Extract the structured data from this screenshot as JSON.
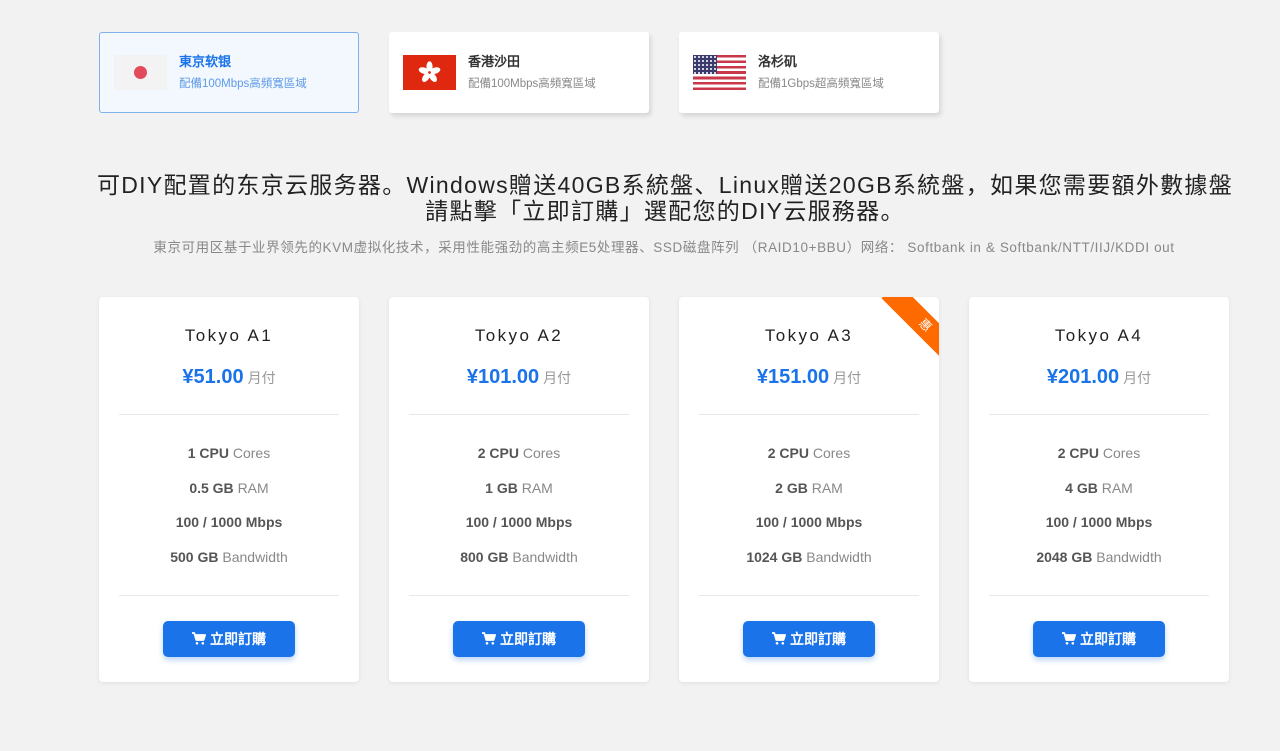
{
  "regions": [
    {
      "name": "東京软银",
      "desc": "配備100Mbps高頻寬區域"
    },
    {
      "name": "香港沙田",
      "desc": "配備100Mbps高頻寬區域"
    },
    {
      "name": "洛杉矶",
      "desc": "配備1Gbps超高頻寬區域"
    }
  ],
  "headline": "可DIY配置的东京云服务器。Windows贈送40GB系統盤、Linux贈送20GB系統盤，如果您需要額外數據盤請點擊「立即訂購」選配您的DIY云服務器。",
  "subline": "東京可用区基于业界领先的KVM虚拟化技术，采用性能强劲的高主频E5处理器、SSD磁盘阵列 （RAID10+BBU）网络： Softbank in & Softbank/NTT/IIJ/KDDI out",
  "buy_label": "立即訂購",
  "period_label": "月付",
  "ribbon_label": "惠",
  "plans": [
    {
      "name": "Tokyo A1",
      "price": "¥51.00",
      "cpu": "1 CPU",
      "cpu_unit": "Cores",
      "ram": "0.5 GB",
      "ram_unit": "RAM",
      "port": "100 / 1000 Mbps",
      "bw": "500 GB",
      "bw_unit": "Bandwidth"
    },
    {
      "name": "Tokyo A2",
      "price": "¥101.00",
      "cpu": "2 CPU",
      "cpu_unit": "Cores",
      "ram": "1 GB",
      "ram_unit": "RAM",
      "port": "100 / 1000 Mbps",
      "bw": "800 GB",
      "bw_unit": "Bandwidth"
    },
    {
      "name": "Tokyo A3",
      "price": "¥151.00",
      "cpu": "2 CPU",
      "cpu_unit": "Cores",
      "ram": "2 GB",
      "ram_unit": "RAM",
      "port": "100 / 1000 Mbps",
      "bw": "1024 GB",
      "bw_unit": "Bandwidth"
    },
    {
      "name": "Tokyo A4",
      "price": "¥201.00",
      "cpu": "2 CPU",
      "cpu_unit": "Cores",
      "ram": "4 GB",
      "ram_unit": "RAM",
      "port": "100 / 1000 Mbps",
      "bw": "2048 GB",
      "bw_unit": "Bandwidth"
    }
  ],
  "colors": {
    "accent": "#1a73e8",
    "ribbon": "#ff6a00",
    "background": "#f2f2f2"
  }
}
